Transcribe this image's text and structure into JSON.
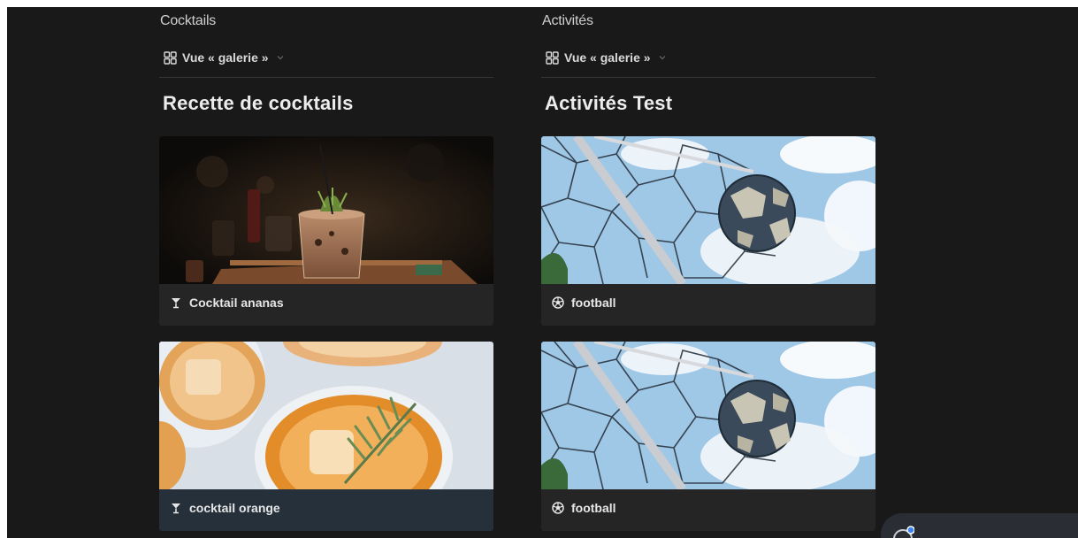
{
  "colors": {
    "background": "#191919",
    "card": "#252525",
    "card_selected": "#26303b",
    "text": "#e6e6e6"
  },
  "columns": [
    {
      "db_title": "Cocktails",
      "view": {
        "icon": "gallery-grid-icon",
        "label": "Vue « galerie »"
      },
      "heading": "Recette de cocktails",
      "cards": [
        {
          "icon": "cocktail-glass-icon",
          "title": "Cocktail ananas",
          "cover": "cocktail-photo"
        },
        {
          "icon": "cocktail-glass-icon",
          "title": "cocktail orange",
          "cover": "orange-cocktails-photo"
        }
      ]
    },
    {
      "db_title": "Activités",
      "view": {
        "icon": "gallery-grid-icon",
        "label": "Vue « galerie »"
      },
      "heading": "Activités Test",
      "cards": [
        {
          "icon": "soccer-ball-icon",
          "title": "football",
          "cover": "football-net-photo"
        },
        {
          "icon": "soccer-ball-icon",
          "title": "football",
          "cover": "football-net-photo"
        }
      ]
    }
  ],
  "widget": {
    "icon": "assistant-icon"
  }
}
